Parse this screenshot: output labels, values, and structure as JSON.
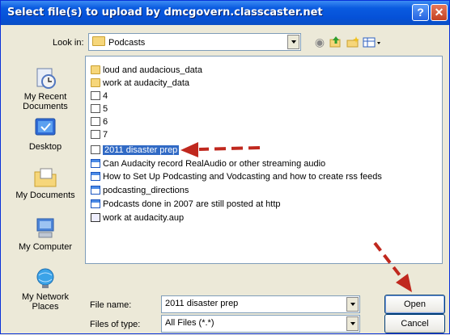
{
  "window": {
    "title": "Select file(s) to upload by dmcgovern.classcaster.net",
    "help_glyph": "?",
    "close_glyph": "✕"
  },
  "toolbar": {
    "look_in_label": "Look in:",
    "look_in_value": "Podcasts",
    "icons": [
      "back-icon",
      "up-folder-icon",
      "new-folder-icon",
      "views-menu-icon"
    ]
  },
  "places": [
    {
      "label": "My Recent Documents",
      "icon": "recent-documents-icon"
    },
    {
      "label": "Desktop",
      "icon": "desktop-icon"
    },
    {
      "label": "My Documents",
      "icon": "my-documents-icon"
    },
    {
      "label": "My Computer",
      "icon": "my-computer-icon"
    },
    {
      "label": "My Network Places",
      "icon": "network-places-icon"
    }
  ],
  "files": [
    {
      "name": "loud and audacious_data",
      "type": "folder"
    },
    {
      "name": "work at audacity_data",
      "type": "folder"
    },
    {
      "name": "4",
      "type": "file"
    },
    {
      "name": "5",
      "type": "file"
    },
    {
      "name": "6",
      "type": "file"
    },
    {
      "name": "7",
      "type": "file"
    },
    {
      "name": "2011 disaster prep",
      "type": "file",
      "selected": true
    },
    {
      "name": "Can Audacity record RealAudio or other streaming audio",
      "type": "doc"
    },
    {
      "name": "How to Set Up Podcasting and Vodcasting and how to create rss feeds",
      "type": "doc"
    },
    {
      "name": "podcasting_directions",
      "type": "doc"
    },
    {
      "name": "Podcasts done in 2007 are still posted at http",
      "type": "doc"
    },
    {
      "name": "work at audacity.aup",
      "type": "aup"
    }
  ],
  "file_name": {
    "label": "File name:",
    "value": "2011 disaster prep"
  },
  "files_of_type": {
    "label": "Files of type:",
    "value": "All Files (*.*)"
  },
  "buttons": {
    "open": "Open",
    "cancel": "Cancel"
  },
  "colors": {
    "title_bar": "#0A5BE0",
    "selection": "#316AC5",
    "annotation_arrow": "#C0281E"
  }
}
